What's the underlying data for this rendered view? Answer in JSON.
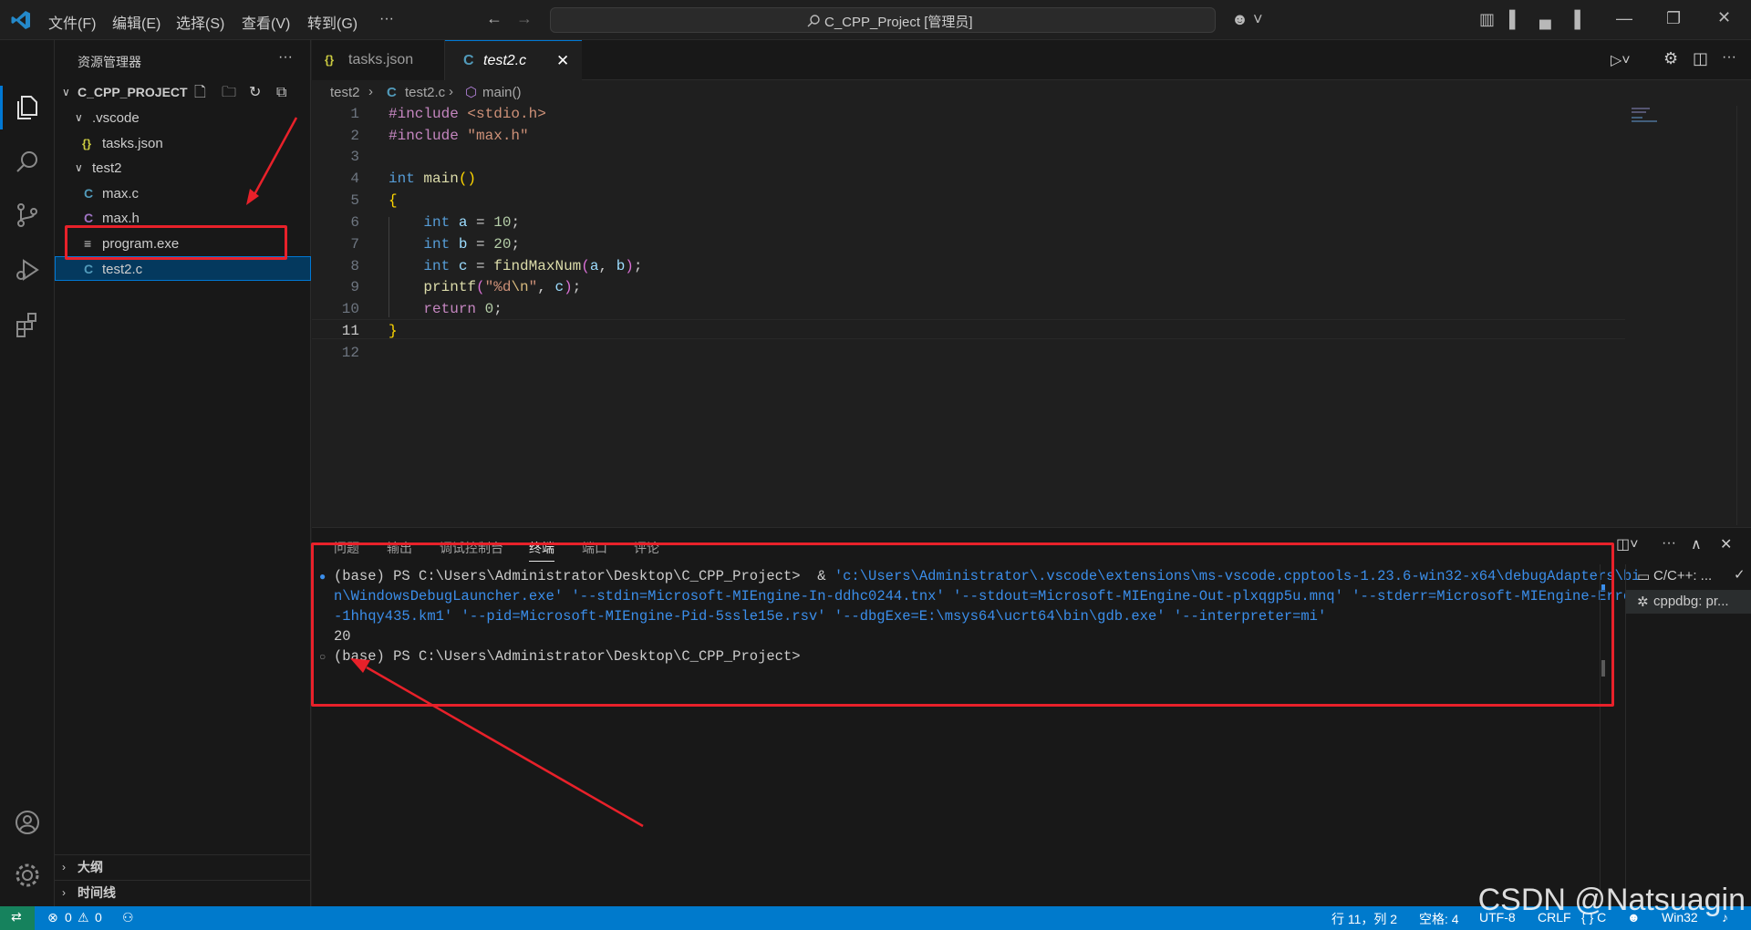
{
  "titlebar": {
    "menu": [
      "文件(F)",
      "编辑(E)",
      "选择(S)",
      "查看(V)",
      "转到(G)",
      "···"
    ],
    "search_text": "C_CPP_Project [管理员]"
  },
  "sidebar": {
    "title": "资源管理器",
    "project": "C_CPP_PROJECT",
    "tree": [
      {
        "label": ".vscode",
        "type": "folder"
      },
      {
        "label": "tasks.json",
        "type": "json"
      },
      {
        "label": "test2",
        "type": "folder"
      },
      {
        "label": "max.c",
        "type": "c"
      },
      {
        "label": "max.h",
        "type": "h"
      },
      {
        "label": "program.exe",
        "type": "exe"
      },
      {
        "label": "test2.c",
        "type": "c"
      }
    ],
    "outline": "大纲",
    "timeline": "时间线"
  },
  "tabs": [
    {
      "label": "tasks.json",
      "icon": "{}"
    },
    {
      "label": "test2.c",
      "icon": "C"
    }
  ],
  "breadcrumb": {
    "folder": "test2",
    "file": "test2.c",
    "symbol": "main()"
  },
  "editor": {
    "line_numbers": [
      "1",
      "2",
      "3",
      "4",
      "5",
      "6",
      "7",
      "8",
      "9",
      "10",
      "11",
      "12"
    ],
    "active_line": 11
  },
  "panel": {
    "tabs": [
      "问题",
      "输出",
      "调试控制台",
      "终端",
      "端口",
      "评论"
    ],
    "active_tab": "终端",
    "terminal": {
      "prompt1": "(base) PS C:\\Users\\Administrator\\Desktop\\C_CPP_Project>",
      "cmd_amp": "&",
      "cmd_path": "'c:\\Users\\Administrator\\.vscode\\extensions\\ms-vscode.cpptools-1.23.6-win32-x64\\debugAdapters\\bi",
      "cmd_line2a": "n\\WindowsDebugLauncher.exe'",
      "cmd_line2b": "'--stdin=Microsoft-MIEngine-In-ddhc0244.tnx' '--stdout=Microsoft-MIEngine-Out-plxqgp5u.mnq' '--stderr=Microsoft-MIEngine-Error",
      "cmd_line3": "-1hhqy435.km1' '--pid=Microsoft-MIEngine-Pid-5ssle15e.rsv' '--dbgExe=E:\\msys64\\ucrt64\\bin\\gdb.exe' '--interpreter=mi'",
      "output": "20",
      "prompt2": "(base) PS C:\\Users\\Administrator\\Desktop\\C_CPP_Project>"
    },
    "terminals": [
      "C/C++: ...",
      "cppdbg: pr..."
    ]
  },
  "statusbar": {
    "errors": "0",
    "warnings": "0",
    "position": "行 11，列 2",
    "spaces": "空格: 4",
    "encoding": "UTF-8",
    "eol": "CRLF",
    "language": "{ } C",
    "platform": "Win32"
  },
  "watermark": "CSDN @Natsuagin"
}
